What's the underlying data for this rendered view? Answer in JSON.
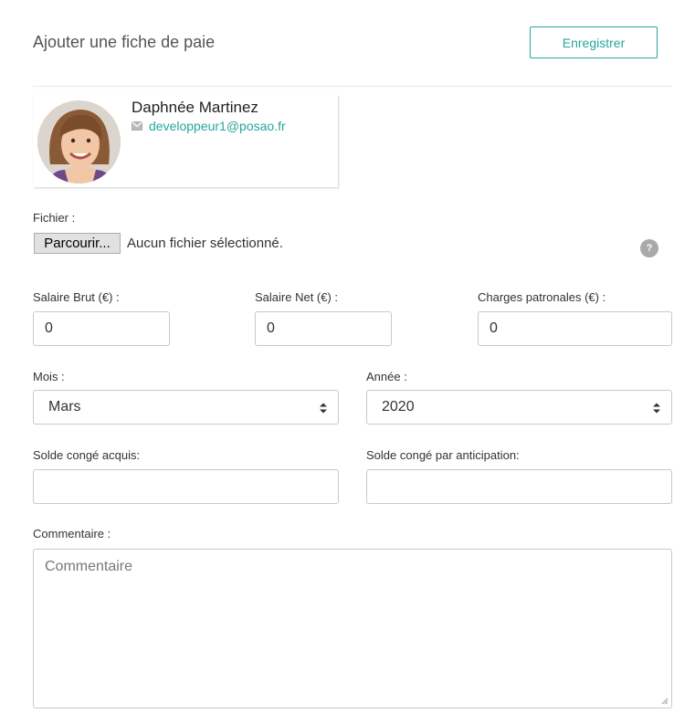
{
  "header": {
    "title": "Ajouter une fiche de paie",
    "save_label": "Enregistrer"
  },
  "employee": {
    "name": "Daphnée Martinez",
    "email": "developpeur1@posao.fr"
  },
  "file": {
    "label": "Fichier :",
    "browse_label": "Parcourir...",
    "status": "Aucun fichier sélectionné.",
    "help": "?"
  },
  "salary": {
    "gross_label": "Salaire Brut (€) :",
    "gross_value": "0",
    "net_label": "Salaire Net (€) :",
    "net_value": "0",
    "charges_label": "Charges patronales (€) :",
    "charges_value": "0"
  },
  "period": {
    "month_label": "Mois :",
    "month_value": "Mars",
    "year_label": "Année :",
    "year_value": "2020"
  },
  "leave": {
    "acquired_label": "Solde congé acquis:",
    "acquired_value": "",
    "anticipation_label": "Solde congé par anticipation:",
    "anticipation_value": ""
  },
  "comment": {
    "label": "Commentaire :",
    "placeholder": "Commentaire"
  },
  "colors": {
    "accent": "#26a69a",
    "border": "#c9c9c9",
    "help_icon": "#a9a9a9"
  }
}
